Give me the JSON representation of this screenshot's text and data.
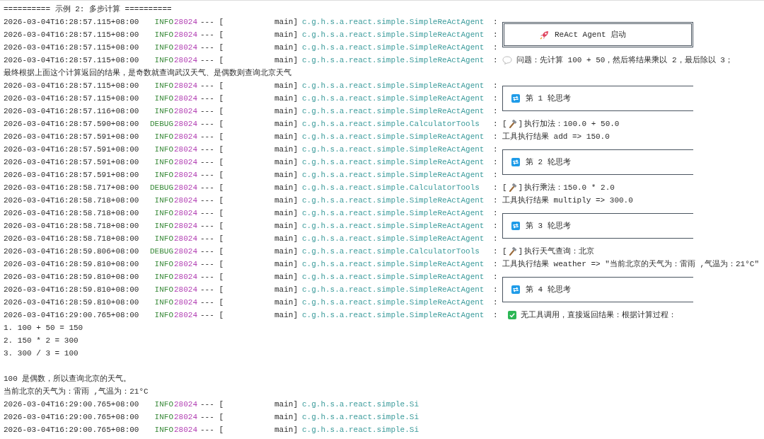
{
  "lines": [
    {
      "kind": "plain",
      "text": "========== 示例 2: 多步计算 =========="
    },
    {
      "kind": "log",
      "time": "2026-03-04T16:28:57.115+08:00",
      "level": "INFO",
      "pid": "28024",
      "sep": "--- [",
      "thread": "main]",
      "logger": "c.g.h.s.a.react.simple.SimpleReActAgent",
      "colon": ":",
      "message": {
        "kind": "banner",
        "text": "ReAct Agent 启动"
      }
    },
    {
      "kind": "log",
      "time": "2026-03-04T16:28:57.115+08:00",
      "level": "INFO",
      "pid": "28024",
      "sep": "--- [",
      "thread": "main]",
      "logger": "c.g.h.s.a.react.simple.SimpleReActAgent",
      "colon": ":"
    },
    {
      "kind": "log",
      "time": "2026-03-04T16:28:57.115+08:00",
      "level": "INFO",
      "pid": "28024",
      "sep": "--- [",
      "thread": "main]",
      "logger": "c.g.h.s.a.react.simple.SimpleReActAgent",
      "colon": ":"
    },
    {
      "kind": "log",
      "time": "2026-03-04T16:28:57.115+08:00",
      "level": "INFO",
      "pid": "28024",
      "sep": "--- [",
      "thread": "main]",
      "logger": "c.g.h.s.a.react.simple.SimpleReActAgent",
      "colon": ":",
      "message": {
        "kind": "question",
        "text": "问题：先计算 100 + 50，然后将结果乘以 2，最后除以 3；"
      }
    },
    {
      "kind": "plain",
      "text": "最终根据上面这个计算返回的结果，是奇数就查询武汉天气、是偶数则查询北京天气"
    },
    {
      "kind": "log",
      "time": "2026-03-04T16:28:57.115+08:00",
      "level": "INFO",
      "pid": "28024",
      "sep": "--- [",
      "thread": "main]",
      "logger": "c.g.h.s.a.react.simple.SimpleReActAgent",
      "colon": ":",
      "message": {
        "kind": "round",
        "text": "第 1 轮思考"
      }
    },
    {
      "kind": "log",
      "time": "2026-03-04T16:28:57.115+08:00",
      "level": "INFO",
      "pid": "28024",
      "sep": "--- [",
      "thread": "main]",
      "logger": "c.g.h.s.a.react.simple.SimpleReActAgent",
      "colon": ":"
    },
    {
      "kind": "log",
      "time": "2026-03-04T16:28:57.116+08:00",
      "level": "INFO",
      "pid": "28024",
      "sep": "--- [",
      "thread": "main]",
      "logger": "c.g.h.s.a.react.simple.SimpleReActAgent",
      "colon": ":"
    },
    {
      "kind": "log",
      "time": "2026-03-04T16:28:57.590+08:00",
      "level": "DEBUG",
      "pid": "28024",
      "sep": "--- [",
      "thread": "main]",
      "logger": "c.g.h.s.a.react.simple.CalculatorTools",
      "colon": ":",
      "message": {
        "kind": "tool_call",
        "open": "[",
        "close": "]",
        "text": "执行加法：100.0 + 50.0"
      }
    },
    {
      "kind": "log",
      "time": "2026-03-04T16:28:57.591+08:00",
      "level": "INFO",
      "pid": "28024",
      "sep": "--- [",
      "thread": "main]",
      "logger": "c.g.h.s.a.react.simple.SimpleReActAgent",
      "colon": ":",
      "message": {
        "kind": "text",
        "text": "工具执行结果 add => 150.0"
      }
    },
    {
      "kind": "log",
      "time": "2026-03-04T16:28:57.591+08:00",
      "level": "INFO",
      "pid": "28024",
      "sep": "--- [",
      "thread": "main]",
      "logger": "c.g.h.s.a.react.simple.SimpleReActAgent",
      "colon": ":",
      "message": {
        "kind": "round",
        "text": "第 2 轮思考"
      }
    },
    {
      "kind": "log",
      "time": "2026-03-04T16:28:57.591+08:00",
      "level": "INFO",
      "pid": "28024",
      "sep": "--- [",
      "thread": "main]",
      "logger": "c.g.h.s.a.react.simple.SimpleReActAgent",
      "colon": ":"
    },
    {
      "kind": "log",
      "time": "2026-03-04T16:28:57.591+08:00",
      "level": "INFO",
      "pid": "28024",
      "sep": "--- [",
      "thread": "main]",
      "logger": "c.g.h.s.a.react.simple.SimpleReActAgent",
      "colon": ":"
    },
    {
      "kind": "log",
      "time": "2026-03-04T16:28:58.717+08:00",
      "level": "DEBUG",
      "pid": "28024",
      "sep": "--- [",
      "thread": "main]",
      "logger": "c.g.h.s.a.react.simple.CalculatorTools",
      "colon": ":",
      "message": {
        "kind": "tool_call",
        "open": "[",
        "close": "]",
        "text": "执行乘法：150.0 * 2.0"
      }
    },
    {
      "kind": "log",
      "time": "2026-03-04T16:28:58.718+08:00",
      "level": "INFO",
      "pid": "28024",
      "sep": "--- [",
      "thread": "main]",
      "logger": "c.g.h.s.a.react.simple.SimpleReActAgent",
      "colon": ":",
      "message": {
        "kind": "text",
        "text": "工具执行结果 multiply => 300.0"
      }
    },
    {
      "kind": "log",
      "time": "2026-03-04T16:28:58.718+08:00",
      "level": "INFO",
      "pid": "28024",
      "sep": "--- [",
      "thread": "main]",
      "logger": "c.g.h.s.a.react.simple.SimpleReActAgent",
      "colon": ":",
      "message": {
        "kind": "round",
        "text": "第 3 轮思考"
      }
    },
    {
      "kind": "log",
      "time": "2026-03-04T16:28:58.718+08:00",
      "level": "INFO",
      "pid": "28024",
      "sep": "--- [",
      "thread": "main]",
      "logger": "c.g.h.s.a.react.simple.SimpleReActAgent",
      "colon": ":"
    },
    {
      "kind": "log",
      "time": "2026-03-04T16:28:58.718+08:00",
      "level": "INFO",
      "pid": "28024",
      "sep": "--- [",
      "thread": "main]",
      "logger": "c.g.h.s.a.react.simple.SimpleReActAgent",
      "colon": ":"
    },
    {
      "kind": "log",
      "time": "2026-03-04T16:28:59.806+08:00",
      "level": "DEBUG",
      "pid": "28024",
      "sep": "--- [",
      "thread": "main]",
      "logger": "c.g.h.s.a.react.simple.CalculatorTools",
      "colon": ":",
      "message": {
        "kind": "tool_call",
        "open": "[",
        "close": "]",
        "text": "执行天气查询：北京"
      }
    },
    {
      "kind": "log",
      "time": "2026-03-04T16:28:59.810+08:00",
      "level": "INFO",
      "pid": "28024",
      "sep": "--- [",
      "thread": "main]",
      "logger": "c.g.h.s.a.react.simple.SimpleReActAgent",
      "colon": ":",
      "message": {
        "kind": "text",
        "text": "工具执行结果 weather => \"当前北京的天气为：雷雨 ,气温为：21°C\""
      }
    },
    {
      "kind": "log",
      "time": "2026-03-04T16:28:59.810+08:00",
      "level": "INFO",
      "pid": "28024",
      "sep": "--- [",
      "thread": "main]",
      "logger": "c.g.h.s.a.react.simple.SimpleReActAgent",
      "colon": ":",
      "message": {
        "kind": "round",
        "text": "第 4 轮思考"
      }
    },
    {
      "kind": "log",
      "time": "2026-03-04T16:28:59.810+08:00",
      "level": "INFO",
      "pid": "28024",
      "sep": "--- [",
      "thread": "main]",
      "logger": "c.g.h.s.a.react.simple.SimpleReActAgent",
      "colon": ":"
    },
    {
      "kind": "log",
      "time": "2026-03-04T16:28:59.810+08:00",
      "level": "INFO",
      "pid": "28024",
      "sep": "--- [",
      "thread": "main]",
      "logger": "c.g.h.s.a.react.simple.SimpleReActAgent",
      "colon": ":"
    },
    {
      "kind": "log",
      "time": "2026-03-04T16:29:00.765+08:00",
      "level": "INFO",
      "pid": "28024",
      "sep": "--- [",
      "thread": "main]",
      "logger": "c.g.h.s.a.react.simple.SimpleReActAgent",
      "colon": ":",
      "message": {
        "kind": "final",
        "text": "无工具调用，直接返回结果：根据计算过程："
      }
    },
    {
      "kind": "plain",
      "text": "1. 100 + 50 = 150"
    },
    {
      "kind": "plain",
      "text": "2. 150 * 2 = 300"
    },
    {
      "kind": "plain",
      "text": "3. 300 / 3 = 100"
    },
    {
      "kind": "blank"
    },
    {
      "kind": "plain",
      "text": "100 是偶数，所以查询北京的天气。"
    },
    {
      "kind": "plain",
      "text": "当前北京的天气为：雷雨 ,气温为：21°C"
    },
    {
      "kind": "log",
      "time": "2026-03-04T16:29:00.765+08:00",
      "level": "INFO",
      "pid": "28024",
      "sep": "--- [",
      "thread": "main]",
      "logger": "c.g.h.s.a.react.simple.Si"
    },
    {
      "kind": "log",
      "time": "2026-03-04T16:29:00.765+08:00",
      "level": "INFO",
      "pid": "28024",
      "sep": "--- [",
      "thread": "main]",
      "logger": "c.g.h.s.a.react.simple.Si"
    },
    {
      "kind": "log",
      "time": "2026-03-04T16:29:00.765+08:00",
      "level": "INFO",
      "pid": "28024",
      "sep": "--- [",
      "thread": "main]",
      "logger": "c.g.h.s.a.react.simple.Si"
    }
  ]
}
